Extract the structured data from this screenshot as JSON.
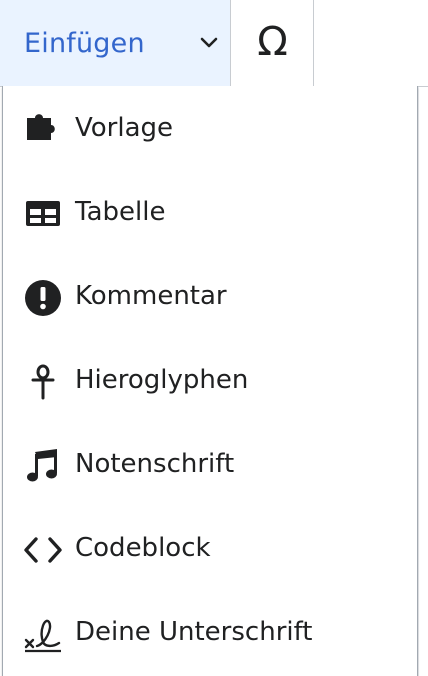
{
  "toolbar": {
    "insert_label": "Einfügen",
    "insert_icon": "chevron-down-icon",
    "special_char_glyph": "Ω",
    "special_char_icon": "omega-icon"
  },
  "menu": {
    "items": [
      {
        "label": "Vorlage",
        "icon": "puzzle-icon"
      },
      {
        "label": "Tabelle",
        "icon": "table-icon"
      },
      {
        "label": "Kommentar",
        "icon": "alert-circle-icon"
      },
      {
        "label": "Hieroglyphen",
        "icon": "ankh-icon"
      },
      {
        "label": "Notenschrift",
        "icon": "music-note-icon"
      },
      {
        "label": "Codeblock",
        "icon": "code-icon"
      },
      {
        "label": "Deine Unterschrift",
        "icon": "signature-icon"
      }
    ]
  },
  "colors": {
    "accent": "#3366cc",
    "text": "#202122",
    "active_tool_bg": "#eaf3ff",
    "border": "#c8ccd1"
  }
}
